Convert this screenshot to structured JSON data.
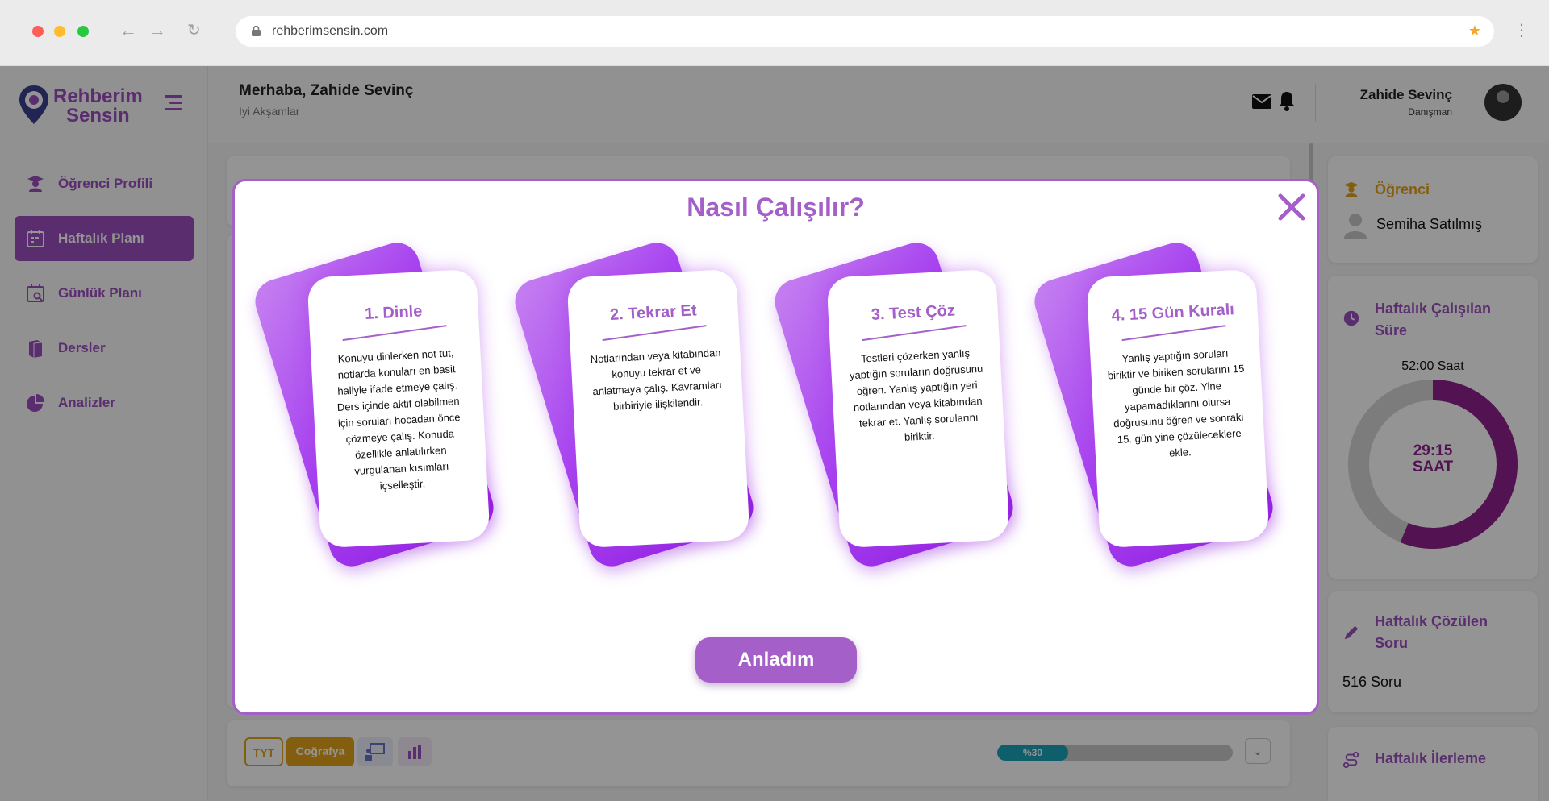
{
  "browser": {
    "url": "rehberimsensin.com"
  },
  "logo": {
    "line1": "Rehberim",
    "line2": "Sensin"
  },
  "sidebar": {
    "items": [
      {
        "label": "Öğrenci Profili",
        "icon": "student-icon"
      },
      {
        "label": "Haftalık Planı",
        "icon": "calendar-week-icon",
        "active": true
      },
      {
        "label": "Günlük Planı",
        "icon": "calendar-day-icon"
      },
      {
        "label": "Dersler",
        "icon": "books-icon"
      },
      {
        "label": "Analizler",
        "icon": "pie-chart-icon"
      }
    ]
  },
  "header": {
    "greeting": "Merhaba, Zahide Sevinç",
    "subtitle": "İyi Akşamlar",
    "user_name": "Zahide Sevinç",
    "user_role": "Danışman"
  },
  "right_panel": {
    "student": {
      "title": "Öğrenci",
      "name": "Semiha Satılmış"
    },
    "weekly_time": {
      "title": "Haftalık Çalışılan Süre",
      "total": "52:00 Saat",
      "done": "29:15",
      "unit": "SAAT",
      "done_fraction": 0.5625
    },
    "weekly_questions": {
      "title": "Haftalık Çözülen Soru",
      "value": "516 Soru"
    },
    "weekly_progress": {
      "title": "Haftalık İlerleme"
    }
  },
  "bottom_row": {
    "exam": "TYT",
    "subject": "Coğrafya",
    "progress_label": "%30",
    "progress": 0.3
  },
  "modal": {
    "title": "Nasıl Çalışılır?",
    "button": "Anladım",
    "cards": [
      {
        "title": "1. Dinle",
        "text": "Konuyu dinlerken not tut, notlarda konuları en basit haliyle ifade etmeye çalış. Ders içinde aktif olabilmen için soruları hocadan önce çözmeye çalış. Konuda özellikle anlatılırken vurgulanan kısımları içselleştir."
      },
      {
        "title": "2. Tekrar Et",
        "text": "Notlarından veya kitabından konuyu tekrar et ve anlatmaya çalış. Kavramları birbiriyle ilişkilendir."
      },
      {
        "title": "3. Test Çöz",
        "text": "Testleri çözerken yanlış yaptığın soruların doğrusunu öğren. Yanlış yaptığın yeri notlarından veya kitabından tekrar et. Yanlış sorularını biriktir."
      },
      {
        "title": "4. 15 Gün Kuralı",
        "text": "Yanlış yaptığın soruları biriktir ve biriken sorularını 15 günde bir çöz. Yine yapamadıklarını olursa doğrusunu öğren ve sonraki 15. gün yine çözüleceklere ekle."
      }
    ]
  },
  "colors": {
    "brand": "#9b4fc0",
    "accent": "#e3a21a",
    "progress": "#1aa3b8",
    "donut_done": "#8f1f8c"
  }
}
